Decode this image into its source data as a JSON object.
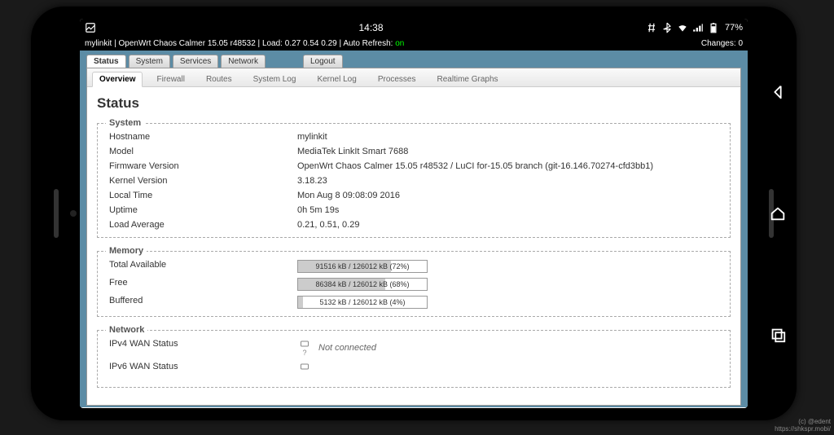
{
  "android": {
    "clock": "14:38",
    "battery_pct": "77%"
  },
  "owrt_header": {
    "hostname": "mylinkit",
    "firmware_short": "OpenWrt Chaos Calmer 15.05 r48532",
    "load_label": "Load:",
    "load": "0.27 0.54 0.29",
    "auto_refresh_label": "Auto Refresh:",
    "auto_refresh_value": "on",
    "changes_label": "Changes:",
    "changes_count": "0"
  },
  "main_tabs": [
    "Status",
    "System",
    "Services",
    "Network",
    "Logout"
  ],
  "active_main_tab": 0,
  "sub_tabs": [
    "Overview",
    "Firewall",
    "Routes",
    "System Log",
    "Kernel Log",
    "Processes",
    "Realtime Graphs"
  ],
  "active_sub_tab": 0,
  "page_title": "Status",
  "system_section": {
    "legend": "System",
    "rows": [
      {
        "k": "Hostname",
        "v": "mylinkit"
      },
      {
        "k": "Model",
        "v": "MediaTek LinkIt Smart 7688"
      },
      {
        "k": "Firmware Version",
        "v": "OpenWrt Chaos Calmer 15.05 r48532 / LuCI for-15.05 branch (git-16.146.70274-cfd3bb1)"
      },
      {
        "k": "Kernel Version",
        "v": "3.18.23"
      },
      {
        "k": "Local Time",
        "v": "Mon Aug 8 09:08:09 2016"
      },
      {
        "k": "Uptime",
        "v": "0h 5m 19s"
      },
      {
        "k": "Load Average",
        "v": "0.21, 0.51, 0.29"
      }
    ]
  },
  "memory_section": {
    "legend": "Memory",
    "rows": [
      {
        "k": "Total Available",
        "label": "91516 kB / 126012 kB (72%)",
        "pct": 72
      },
      {
        "k": "Free",
        "label": "86384 kB / 126012 kB (68%)",
        "pct": 68
      },
      {
        "k": "Buffered",
        "label": "5132 kB / 126012 kB (4%)",
        "pct": 4
      }
    ]
  },
  "network_section": {
    "legend": "Network",
    "rows": [
      {
        "k": "IPv4 WAN Status",
        "v": "Not connected",
        "icon_mark": "?"
      },
      {
        "k": "IPv6 WAN Status",
        "v": "",
        "icon_mark": ""
      }
    ]
  },
  "watermark": {
    "line1": "(c) @edent",
    "line2": "https://shkspr.mobi/"
  }
}
